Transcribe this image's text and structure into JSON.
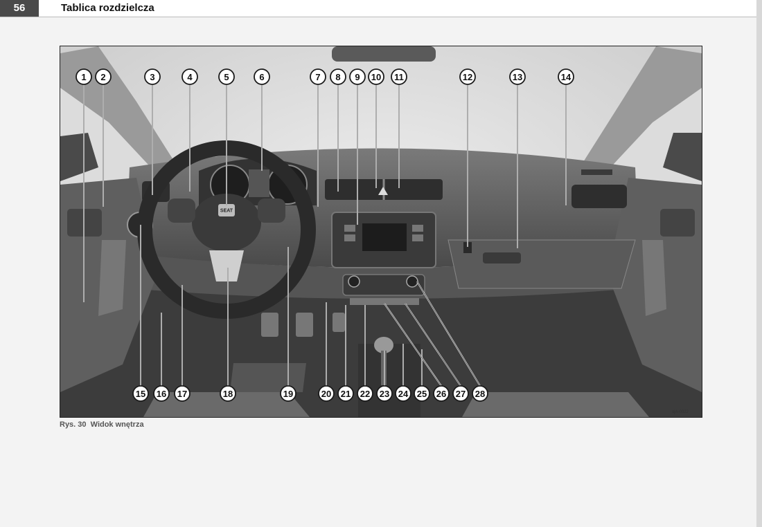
{
  "header": {
    "page_number": "56",
    "title": "Tablica rozdzielcza"
  },
  "figure": {
    "caption_num": "Rys. 30",
    "caption_text": "Widok wnętrza",
    "code": "sjA-0022",
    "brand": "SEAT",
    "callouts_top": [
      "1",
      "2",
      "3",
      "4",
      "5",
      "6",
      "7",
      "8",
      "9",
      "10",
      "11",
      "12",
      "13",
      "14"
    ],
    "callouts_bottom": [
      "15",
      "16",
      "17",
      "18",
      "19",
      "20",
      "21",
      "22",
      "23",
      "24",
      "25",
      "26",
      "27",
      "28"
    ]
  }
}
